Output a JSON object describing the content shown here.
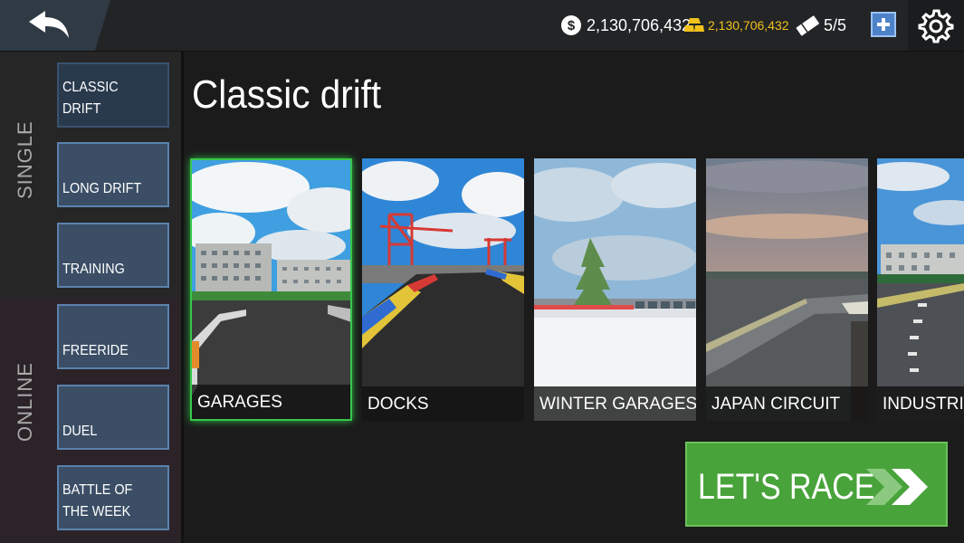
{
  "topbar": {
    "cash": "2,130,706,432",
    "cash_icon_symbol": "$",
    "gold": "2,130,706,432",
    "tickets": "5/5"
  },
  "sidebar": {
    "single_label": "SINGLE",
    "online_label": "ONLINE",
    "items": [
      {
        "label": "CLASSIC DRIFT",
        "active": true
      },
      {
        "label": "LONG DRIFT"
      },
      {
        "label": "TRAINING"
      },
      {
        "label": "FREERIDE"
      },
      {
        "label": "DUEL"
      },
      {
        "label": "BATTLE OF THE WEEK"
      }
    ]
  },
  "main": {
    "title": "Classic drift",
    "tracks": [
      {
        "label": "GARAGES",
        "selected": true
      },
      {
        "label": "DOCKS"
      },
      {
        "label": "WINTER GARAGES"
      },
      {
        "label": "JAPAN CIRCUIT"
      },
      {
        "label": "INDUSTRIAL"
      }
    ],
    "race_label": "LET'S RACE"
  },
  "icons": {
    "back": "back-arrow-icon",
    "cash": "dollar-coin-icon",
    "gold": "gold-bars-icon",
    "ticket": "ticket-icon",
    "plus": "plus-icon",
    "settings": "gear-icon",
    "race": "double-chevron-icon"
  },
  "colors": {
    "accent_green": "#49a33b",
    "selection_green": "#37c84c",
    "mode_button": "#3b4e66",
    "gold_text": "#f2c21b"
  }
}
